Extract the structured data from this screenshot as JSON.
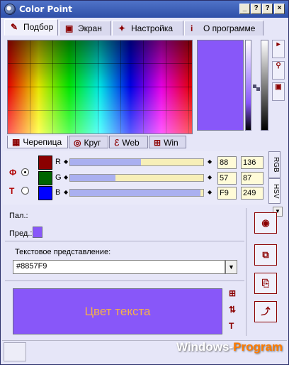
{
  "window": {
    "title": "Color Point",
    "controls": [
      "×",
      "?",
      "?"
    ],
    "minimize_label": "_"
  },
  "main_tabs": [
    {
      "label": "Подбор",
      "icon": "brush-icon",
      "glyph": "✎"
    },
    {
      "label": "Экран",
      "icon": "monitor-icon",
      "glyph": "▣"
    },
    {
      "label": "Настройка",
      "icon": "wrench-icon",
      "glyph": "✦"
    },
    {
      "label": "О программе",
      "icon": "info-icon",
      "glyph": "i"
    }
  ],
  "palette_tabs": [
    {
      "label": "Черепица",
      "glyph": "▦"
    },
    {
      "label": "Круг",
      "glyph": "◎"
    },
    {
      "label": "Web",
      "glyph": "ℰ"
    },
    {
      "label": "Win",
      "glyph": "⊞"
    }
  ],
  "color": {
    "current_hex": "#8857F9",
    "accent": "#8857f9",
    "text_color": "#f5b14a"
  },
  "mode_labels": {
    "background": "Ф",
    "text": "Т"
  },
  "channels": [
    {
      "label": "R",
      "hex": "88",
      "dec": "136",
      "level": 0.53,
      "swatch": "#8b0000"
    },
    {
      "label": "G",
      "hex": "57",
      "dec": "87",
      "level": 0.34,
      "swatch": "#006400"
    },
    {
      "label": "B",
      "hex": "F9",
      "dec": "249",
      "level": 0.98,
      "swatch": "#0000ff"
    }
  ],
  "vertical_tabs": {
    "rgb": "RGB",
    "hsv": "HSV"
  },
  "labels": {
    "palette": "Пал.:",
    "previous": "Пред.:",
    "text_repr": "Текстовое представление:",
    "sample": "Цвет текста",
    "dropdown_arrow": "▼"
  },
  "watermark": {
    "left": "Windows-",
    "right": "Program"
  }
}
